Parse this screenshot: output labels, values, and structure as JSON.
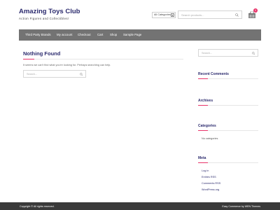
{
  "site": {
    "title": "Amazing Toys Club",
    "tagline": "Action Figures and Collectibles!"
  },
  "header": {
    "category_select_value": "All Categories",
    "search_placeholder": "Search products...",
    "cart_count": "0",
    "icons": [
      "chevron-down-icon",
      "search-icon",
      "shopping-basket-icon"
    ]
  },
  "nav": {
    "items": [
      {
        "label": "Third Party Brands"
      },
      {
        "label": "My account"
      },
      {
        "label": "Checkout"
      },
      {
        "label": "Cart"
      },
      {
        "label": "Shop"
      },
      {
        "label": "Sample Page"
      }
    ]
  },
  "main": {
    "title": "Nothing Found",
    "message": "It seems we can't find what you're looking for. Perhaps searching can help.",
    "search_placeholder": "Search..."
  },
  "sidebar": {
    "search_placeholder": "Search...",
    "recent_comments_title": "Recent Comments",
    "archives_title": "Archives",
    "categories_title": "Categories",
    "categories_empty": "No categories",
    "meta_title": "Meta",
    "meta_links": [
      {
        "label": "Log in"
      },
      {
        "label": "Entries RSS"
      },
      {
        "label": "Comments RSS"
      },
      {
        "label": "WordPress.org"
      }
    ]
  },
  "footer": {
    "copyright": "Copyright © All rights reserved.",
    "credit": "Easy Commerce by WEN Themes"
  },
  "colors": {
    "accent": "#e8336a",
    "title": "#2c2b6e",
    "nav_bg": "#737373",
    "footer_bg": "#3a3a3a"
  }
}
